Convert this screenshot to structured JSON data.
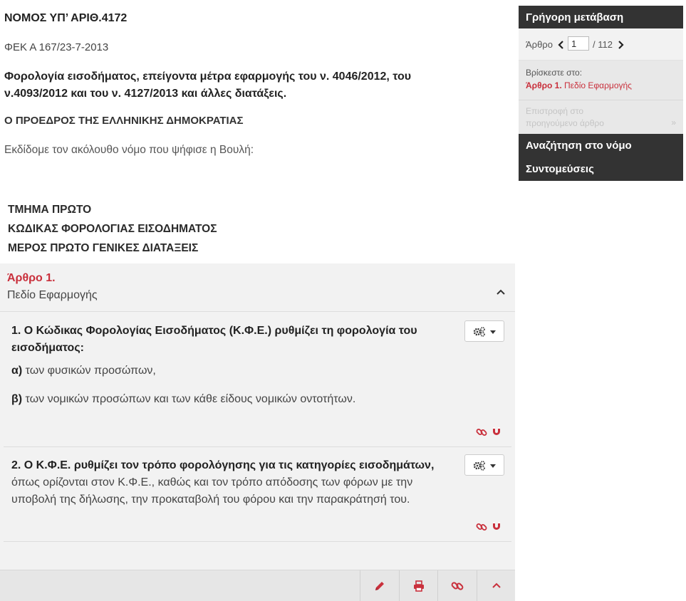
{
  "law": {
    "title": "ΝΟΜΟΣ ΥΠ’ ΑΡΙΘ.4172",
    "fek": "ΦΕΚ Α 167/23-7-2013",
    "subject": "Φορολογία εισοδήματος, επείγοντα μέτρα εφαρμογής του ν. 4046/2012, του ν.4093/2012 και του ν. 4127/2013 και άλλες διατάξεις.",
    "president": "Ο ΠΡΟΕΔΡΟΣ ΤΗΣ ΕΛΛΗΝΙΚΗΣ ΔΗΜΟΚΡΑΤΙΑΣ",
    "intro": "Εκδίδομε τον ακόλουθο νόμο που ψήφισε η Βουλή:",
    "sections": [
      "ΤΜΗΜΑ ΠΡΩΤΟ",
      "ΚΩΔΙΚΑΣ ΦΟΡΟΛΟΓΙΑΣ ΕΙΣΟΔΗΜΑΤΟΣ",
      "ΜΕΡΟΣ ΠΡΩΤΟ ΓΕΝΙΚΕΣ ΔΙΑΤΑΞΕΙΣ"
    ]
  },
  "article": {
    "number": "Άρθρο 1.",
    "name": "Πεδίο Εφαρμογής",
    "paragraphs": [
      {
        "bold": "1. Ο Κώδικας Φορολογίας Εισοδήματος (Κ.Φ.Ε.) ρυθμίζει τη φορολογία του εισοδήματος:",
        "text": "",
        "items": [
          {
            "letter": "α)",
            "text": " των φυσικών προσώπων,"
          },
          {
            "letter": "β)",
            "text": " των νομικών προσώπων και των κάθε είδους νομικών οντοτήτων."
          }
        ]
      },
      {
        "bold": "2. Ο Κ.Φ.Ε. ρυθμίζει τον τρόπο φορολόγησης για τις κατηγορίες εισοδημάτων,",
        "text": " όπως ορίζονται στον Κ.Φ.Ε., καθώς και τον τρόπο απόδοσης των φόρων με την υποβολή της δήλωσης, την προκαταβολή του φόρου και την παρακράτησή του."
      }
    ]
  },
  "sidebar": {
    "quick_nav_title": "Γρήγορη μετάβαση",
    "article_label": "Άρθρο",
    "article_input_value": "1",
    "article_total": "/ 112",
    "location_label": "Βρίσκεστε στο:",
    "location_article": "Άρθρο 1.",
    "location_name": " Πεδίο Εφαρμογής",
    "prev_article": "Επιστροφή στο προηγούμενο άρθρο",
    "prev_arrow": "»",
    "search_law": "Αναζήτηση στο νόμο",
    "shortcuts": "Συντομεύσεις"
  },
  "colors": {
    "accent_red": "#c9303c",
    "dark_panel": "#333333",
    "light_panel": "#f2f2f2"
  },
  "icons": [
    "chevron-up-icon",
    "gear-icon",
    "caret-down-icon",
    "link-icon",
    "magnet-icon",
    "pencil-icon",
    "print-icon",
    "chevron-left-icon",
    "chevron-right-icon"
  ]
}
